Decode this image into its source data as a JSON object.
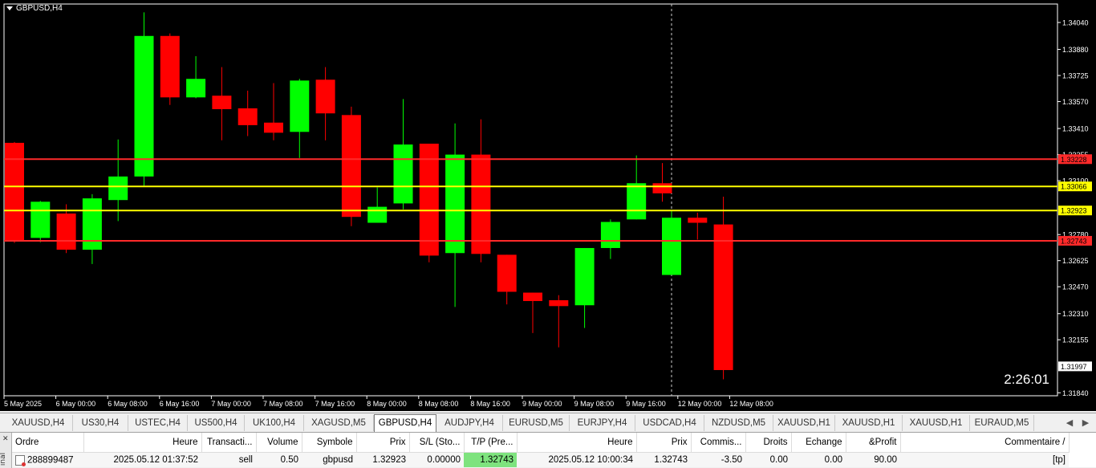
{
  "chart": {
    "symbol_label": "GBPUSD,H4",
    "timer": "2:26:01",
    "colors": {
      "background": "#000000",
      "bull": "#00ff00",
      "bear": "#ff0000",
      "axis": "#ffffff"
    },
    "price_ticks": [
      "1.34040",
      "1.33880",
      "1.33725",
      "1.33570",
      "1.33410",
      "1.33255",
      "1.33100",
      "1.32780",
      "1.32625",
      "1.32470",
      "1.32310",
      "1.32155",
      "1.31840"
    ],
    "time_labels": [
      "5 May 2025",
      "6 May 00:00",
      "6 May 08:00",
      "6 May 16:00",
      "7 May 00:00",
      "7 May 08:00",
      "7 May 16:00",
      "8 May 00:00",
      "8 May 08:00",
      "8 May 16:00",
      "9 May 00:00",
      "9 May 08:00",
      "9 May 16:00",
      "12 May 00:00",
      "12 May 08:00"
    ],
    "levels": [
      {
        "label": "1.33228",
        "price": 1.33228,
        "color": "#ff2a2a"
      },
      {
        "label": "1.33066",
        "price": 1.33066,
        "color": "#ffff00"
      },
      {
        "label": "1.32923",
        "price": 1.32923,
        "color": "#ffff00"
      },
      {
        "label": "1.32743",
        "price": 1.32743,
        "color": "#ff2a2a"
      }
    ],
    "current_price_label": "1.31997",
    "candles": [
      {
        "o": 1.33325,
        "h": 1.3333,
        "l": 1.3273,
        "c": 1.32745
      },
      {
        "o": 1.3276,
        "h": 1.3298,
        "l": 1.32735,
        "c": 1.32975
      },
      {
        "o": 1.32905,
        "h": 1.3296,
        "l": 1.3267,
        "c": 1.3269
      },
      {
        "o": 1.3269,
        "h": 1.3302,
        "l": 1.32605,
        "c": 1.32995
      },
      {
        "o": 1.32985,
        "h": 1.33345,
        "l": 1.3286,
        "c": 1.33125
      },
      {
        "o": 1.33125,
        "h": 1.341,
        "l": 1.3307,
        "c": 1.3396
      },
      {
        "o": 1.3396,
        "h": 1.33975,
        "l": 1.3355,
        "c": 1.33595
      },
      {
        "o": 1.33595,
        "h": 1.3384,
        "l": 1.3359,
        "c": 1.33705
      },
      {
        "o": 1.33605,
        "h": 1.33775,
        "l": 1.3334,
        "c": 1.33525
      },
      {
        "o": 1.3353,
        "h": 1.33635,
        "l": 1.33365,
        "c": 1.3343
      },
      {
        "o": 1.33445,
        "h": 1.3368,
        "l": 1.3334,
        "c": 1.33385
      },
      {
        "o": 1.3339,
        "h": 1.33705,
        "l": 1.33235,
        "c": 1.33695
      },
      {
        "o": 1.337,
        "h": 1.33775,
        "l": 1.3334,
        "c": 1.335
      },
      {
        "o": 1.3349,
        "h": 1.3354,
        "l": 1.3283,
        "c": 1.32885
      },
      {
        "o": 1.3285,
        "h": 1.3306,
        "l": 1.3285,
        "c": 1.32945
      },
      {
        "o": 1.32965,
        "h": 1.33585,
        "l": 1.3293,
        "c": 1.33315
      },
      {
        "o": 1.3332,
        "h": 1.3332,
        "l": 1.32615,
        "c": 1.32655
      },
      {
        "o": 1.3267,
        "h": 1.3344,
        "l": 1.3235,
        "c": 1.33255
      },
      {
        "o": 1.33255,
        "h": 1.33465,
        "l": 1.32615,
        "c": 1.32665
      },
      {
        "o": 1.3266,
        "h": 1.3266,
        "l": 1.32365,
        "c": 1.3244
      },
      {
        "o": 1.32435,
        "h": 1.3242,
        "l": 1.32195,
        "c": 1.32385
      },
      {
        "o": 1.3239,
        "h": 1.3242,
        "l": 1.3211,
        "c": 1.32355
      },
      {
        "o": 1.3236,
        "h": 1.327,
        "l": 1.32225,
        "c": 1.327
      },
      {
        "o": 1.327,
        "h": 1.3287,
        "l": 1.32635,
        "c": 1.32855
      },
      {
        "o": 1.3287,
        "h": 1.3325,
        "l": 1.3287,
        "c": 1.33085
      },
      {
        "o": 1.33085,
        "h": 1.33205,
        "l": 1.32975,
        "c": 1.33025
      },
      {
        "o": 1.3254,
        "h": 1.32925,
        "l": 1.3254,
        "c": 1.3288
      },
      {
        "o": 1.3288,
        "h": 1.3291,
        "l": 1.3275,
        "c": 1.3285
      },
      {
        "o": 1.3284,
        "h": 1.33005,
        "l": 1.3192,
        "c": 1.31975
      }
    ]
  },
  "tabs": {
    "items": [
      "XAUUSD,H4",
      "US30,H4",
      "USTEC,H4",
      "US500,H4",
      "UK100,H4",
      "XAGUSD,M5",
      "GBPUSD,H4",
      "AUDJPY,H4",
      "EURUSD,M5",
      "EURJPY,H4",
      "USDCAD,H4",
      "NZDUSD,M5",
      "XAUUSD,H1",
      "XAUUSD,H1",
      "XAUUSD,H1",
      "EURAUD,M5"
    ],
    "active_index": 6
  },
  "terminal": {
    "side_label": "inal",
    "columns": [
      "Ordre",
      "Heure",
      "Transacti...",
      "Volume",
      "Symbole",
      "Prix",
      "S/L (Sto...",
      "T/P (Pre...",
      "Heure",
      "Prix",
      "Commis...",
      "Droits",
      "Echange",
      "&Profit",
      "Commentaire"
    ],
    "row": [
      "288899487",
      "2025.05.12 01:37:52",
      "sell",
      "0.50",
      "gbpusd",
      "1.32923",
      "0.00000",
      "1.32743",
      "2025.05.12 10:00:34",
      "1.32743",
      "-3.50",
      "0.00",
      "0.00",
      "90.00",
      "[tp]"
    ]
  }
}
